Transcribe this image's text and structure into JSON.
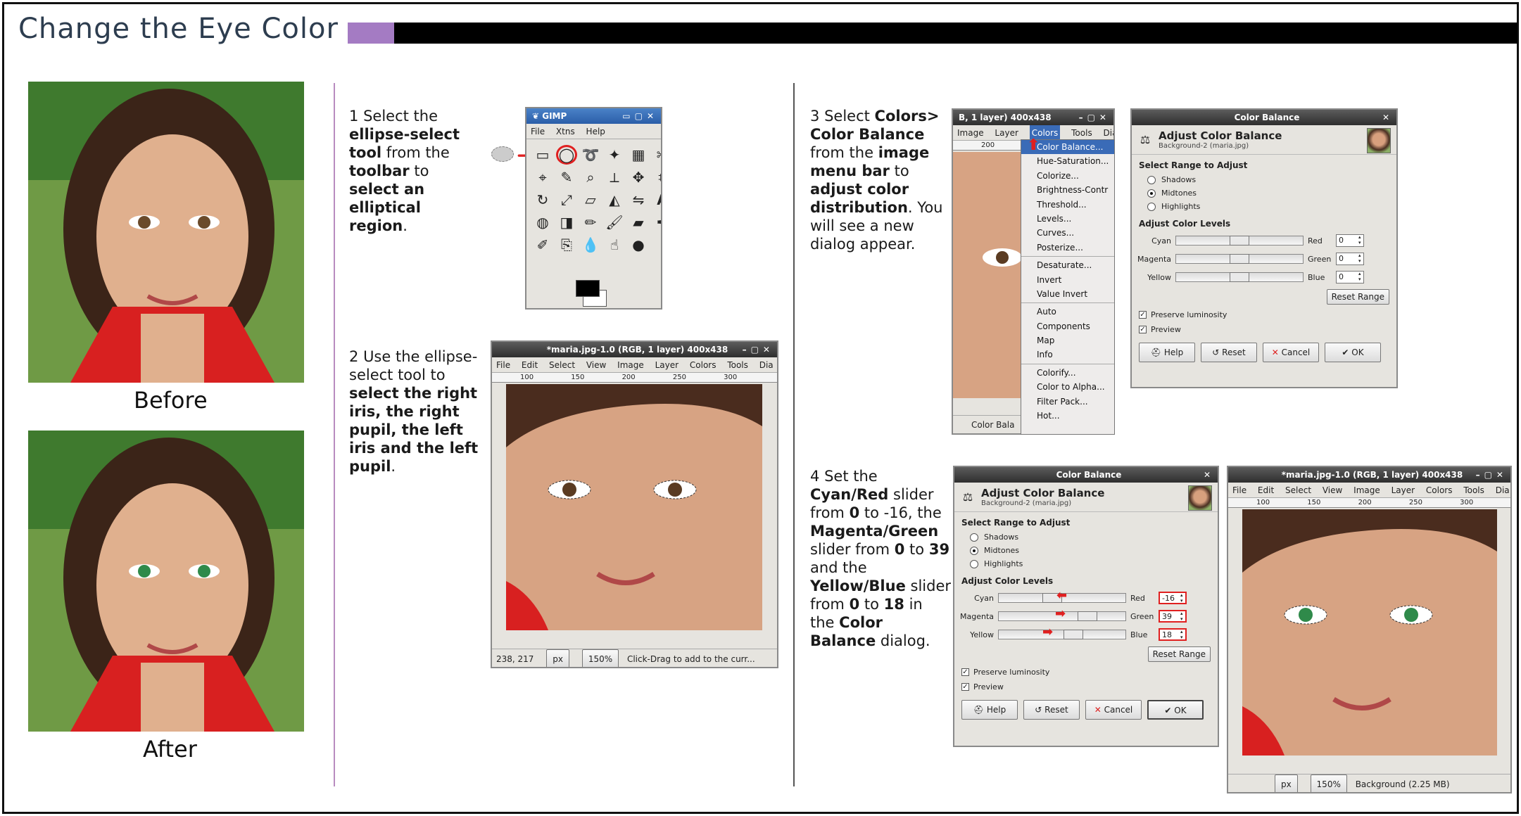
{
  "title": "Change the Eye Color",
  "captions": {
    "before": "Before",
    "after": "After"
  },
  "step1": {
    "num": "1",
    "t1": "Select the",
    "b1": "ellipse-select tool",
    "t2": "from the",
    "b2": "toolbar",
    "t3": "to",
    "b3": "select an elliptical region",
    "t4": "."
  },
  "step2": {
    "num": "2",
    "t1": "Use the ellipse-select tool to",
    "b1": "select the right iris, the right pupil, the left iris and the left pupil",
    "t2": "."
  },
  "step3": {
    "num": "3",
    "t1": "Select",
    "b1": "Colors>",
    "b2": "Color Balance",
    "t2": "from the",
    "b3": "image menu bar",
    "t3": "to",
    "b4": "adjust color distribution",
    "t4": ".",
    "t5": "You will see a new dialog appear."
  },
  "step4": {
    "num": "4",
    "t1": "Set the",
    "b1": "Cyan/Red",
    "t2": "slider from",
    "b2": "0",
    "t3": "to -16, the",
    "b3": "Magenta/Green",
    "t4": "slider from",
    "b4": "0",
    "t5": "to",
    "b5": "39",
    "t6": "and the",
    "b6": "Yellow/Blue",
    "t7": "slider from",
    "b7": "0",
    "t8": "to",
    "b8": "18",
    "t9": "in the",
    "b9": "Color Balance",
    "t10": "dialog."
  },
  "gimp_toolbox": {
    "title": "GIMP",
    "menu": [
      "File",
      "Xtns",
      "Help"
    ]
  },
  "image_window": {
    "title": "*maria.jpg-1.0 (RGB, 1 layer) 400x438",
    "title_partial": "B, 1 layer) 400x438",
    "menu": [
      "File",
      "Edit",
      "Select",
      "View",
      "Image",
      "Layer",
      "Colors",
      "Tools",
      "Dia"
    ],
    "menu_partial": [
      "Image",
      "Layer",
      "Colors",
      "Tools",
      "Dia"
    ],
    "ruler": [
      "100",
      "150",
      "200",
      "250",
      "300"
    ],
    "ruler_partial": [
      "200"
    ],
    "coords": "238, 217",
    "unit": "px",
    "zoom": "150%",
    "status": "Click-Drag to add to the curr...",
    "status_step4": "Background (2.25 MB)",
    "status_partial": "Color Bala"
  },
  "colors_menu": {
    "items": [
      "Color Balance...",
      "Hue-Saturation...",
      "Colorize...",
      "Brightness-Contr",
      "Threshold...",
      "Levels...",
      "Curves...",
      "Posterize...",
      "Desaturate...",
      "Invert",
      "Value Invert",
      "Auto",
      "Components",
      "Map",
      "Info",
      "Colorify...",
      "Color to Alpha...",
      "Filter Pack...",
      "Hot..."
    ]
  },
  "color_balance": {
    "window_title": "Color Balance",
    "heading": "Adjust Color Balance",
    "sub": "Background-2 (maria.jpg)",
    "range_label": "Select Range to Adjust",
    "ranges": [
      "Shadows",
      "Midtones",
      "Highlights"
    ],
    "selected_range": "Midtones",
    "levels_label": "Adjust Color Levels",
    "sliders": [
      {
        "left": "Cyan",
        "right": "Red"
      },
      {
        "left": "Magenta",
        "right": "Green"
      },
      {
        "left": "Yellow",
        "right": "Blue"
      }
    ],
    "initial_values": [
      "0",
      "0",
      "0"
    ],
    "final_values": [
      "-16",
      "39",
      "18"
    ],
    "reset_range": "Reset Range",
    "preserve": "Preserve luminosity",
    "preview": "Preview",
    "buttons": [
      "Help",
      "Reset",
      "Cancel",
      "OK"
    ]
  }
}
